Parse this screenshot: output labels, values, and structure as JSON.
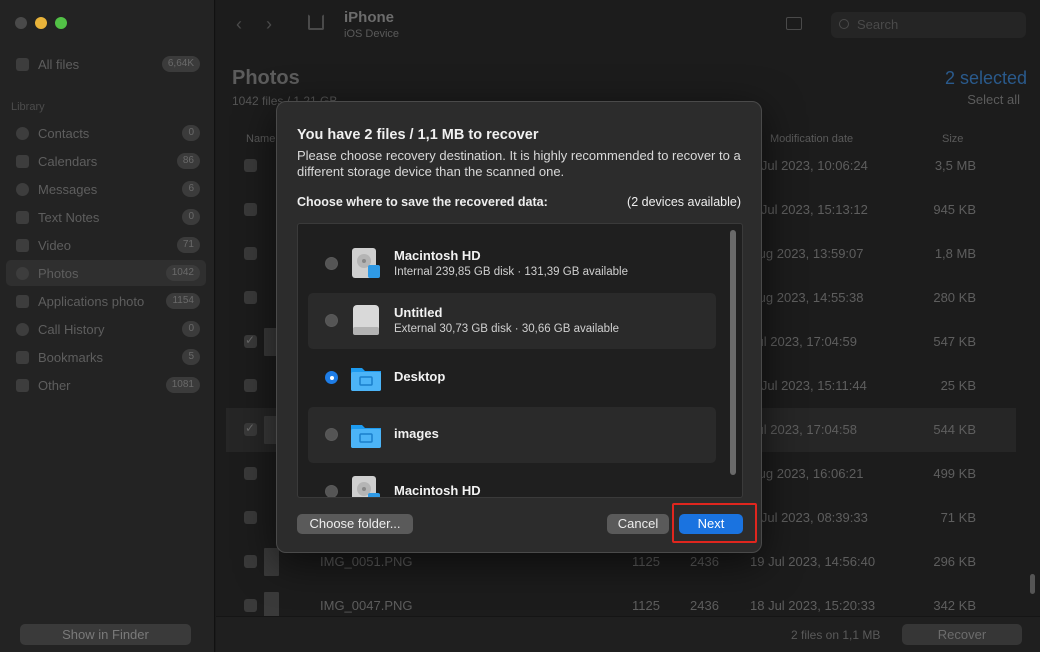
{
  "sidebar": {
    "items": [
      {
        "label": "All files",
        "badge": "6,64K"
      },
      {
        "label": "Contacts",
        "badge": "0"
      },
      {
        "label": "Calendars",
        "badge": "86"
      },
      {
        "label": "Messages",
        "badge": "6"
      },
      {
        "label": "Text Notes",
        "badge": "0"
      },
      {
        "label": "Video",
        "badge": "71"
      },
      {
        "label": "Photos",
        "badge": "1042"
      },
      {
        "label": "Applications photo",
        "badge": "1154"
      },
      {
        "label": "Call History",
        "badge": "0"
      },
      {
        "label": "Bookmarks",
        "badge": "5"
      },
      {
        "label": "Other",
        "badge": "1081"
      }
    ],
    "section_label": "Library",
    "show_in_finder": "Show in Finder"
  },
  "device": {
    "name": "iPhone",
    "type": "iOS Device"
  },
  "search": {
    "placeholder": "Search"
  },
  "page": {
    "title": "Photos",
    "subtitle": "1042 files / 1,21 GB",
    "selected": "2 selected",
    "select_all": "Select all"
  },
  "columns": {
    "name": "Name",
    "modification_date": "Modification date",
    "size": "Size"
  },
  "rows": [
    {
      "name": "",
      "w": "",
      "h": "",
      "date": "1 Jul 2023, 10:06:24",
      "size": "3,5 MB",
      "checked": false
    },
    {
      "name": "",
      "w": "",
      "h": "",
      "date": "0 Jul 2023, 15:13:12",
      "size": "945 KB",
      "checked": false
    },
    {
      "name": "",
      "w": "",
      "h": "",
      "date": "Aug 2023, 13:59:07",
      "size": "1,8 MB",
      "checked": false
    },
    {
      "name": "",
      "w": "",
      "h": "",
      "date": "Aug 2023, 14:55:38",
      "size": "280 KB",
      "checked": false
    },
    {
      "name": "",
      "w": "",
      "h": "",
      "date": "Jul 2023, 17:04:59",
      "size": "547 KB",
      "checked": true
    },
    {
      "name": "",
      "w": "",
      "h": "",
      "date": "5 Jul 2023, 15:11:44",
      "size": "25 KB",
      "checked": false
    },
    {
      "name": "",
      "w": "",
      "h": "",
      "date": "Jul 2023, 17:04:58",
      "size": "544 KB",
      "checked": true
    },
    {
      "name": "",
      "w": "",
      "h": "",
      "date": "Aug 2023, 16:06:21",
      "size": "499 KB",
      "checked": false
    },
    {
      "name": "",
      "w": "",
      "h": "",
      "date": "7 Jul 2023, 08:39:33",
      "size": "71 KB",
      "checked": false
    },
    {
      "name": "IMG_0051.PNG",
      "w": "1125",
      "h": "2436",
      "date": "19 Jul 2023, 14:56:40",
      "size": "296 KB",
      "checked": false
    },
    {
      "name": "IMG_0047.PNG",
      "w": "1125",
      "h": "2436",
      "date": "18 Jul 2023, 15:20:33",
      "size": "342 KB",
      "checked": false
    }
  ],
  "footer": {
    "files_on": "2 files on 1,1 MB",
    "recover": "Recover"
  },
  "modal": {
    "title": "You have 2 files / 1,1 MB to recover",
    "description": "Please choose recovery destination. It is highly recommended to recover to a different storage device than the scanned one.",
    "choose_label": "Choose where to save the recovered data:",
    "devices_available": "(2 devices available)",
    "destinations": [
      {
        "name": "Macintosh HD",
        "detail": "Internal 239,85 GB disk · 131,39 GB available",
        "icon": "internal-disk-icon",
        "selected": false
      },
      {
        "name": "Untitled",
        "detail": "External 30,73 GB disk · 30,66 GB available",
        "icon": "external-disk-icon",
        "selected": false
      },
      {
        "name": "Desktop",
        "detail": "",
        "icon": "folder-icon",
        "selected": true
      },
      {
        "name": "images",
        "detail": "",
        "icon": "folder-icon",
        "selected": false
      },
      {
        "name": "Macintosh HD",
        "detail": "",
        "icon": "internal-disk-icon",
        "selected": false
      }
    ],
    "choose_folder": "Choose folder...",
    "cancel": "Cancel",
    "next": "Next"
  },
  "colors": {
    "accent": "#1a73e0",
    "highlight": "#e0261e",
    "selected_text": "#2a5a8c"
  }
}
